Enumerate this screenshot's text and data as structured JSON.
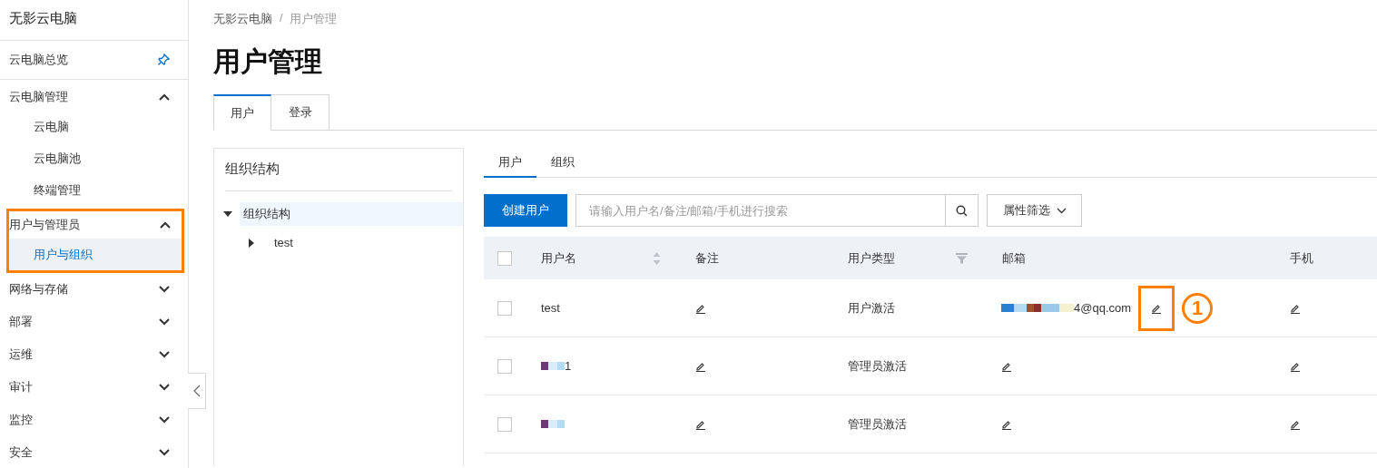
{
  "sidebar": {
    "title": "无影云电脑",
    "pinned_item": {
      "label": "云电脑总览"
    },
    "groups": [
      {
        "label": "云电脑管理",
        "expanded": true,
        "highlighted": false,
        "children": [
          {
            "label": "云电脑",
            "selected": false
          },
          {
            "label": "云电脑池",
            "selected": false
          },
          {
            "label": "终端管理",
            "selected": false
          }
        ]
      },
      {
        "label": "用户与管理员",
        "expanded": true,
        "highlighted": true,
        "children": [
          {
            "label": "用户与组织",
            "selected": true
          }
        ]
      },
      {
        "label": "网络与存储",
        "expanded": false,
        "highlighted": false
      },
      {
        "label": "部署",
        "expanded": false,
        "highlighted": false
      },
      {
        "label": "运维",
        "expanded": false,
        "highlighted": false
      },
      {
        "label": "审计",
        "expanded": false,
        "highlighted": false
      },
      {
        "label": "监控",
        "expanded": false,
        "highlighted": false
      },
      {
        "label": "安全",
        "expanded": false,
        "highlighted": false
      }
    ]
  },
  "breadcrumb": {
    "items": [
      "无影云电脑",
      "用户管理"
    ],
    "separator": "/"
  },
  "page_title": "用户管理",
  "tabs": [
    {
      "label": "用户",
      "selected": true
    },
    {
      "label": "登录",
      "selected": false
    }
  ],
  "org_panel": {
    "title": "组织结构",
    "tree": [
      {
        "label": "组织结构",
        "expanded": true,
        "selected": true,
        "children": [
          {
            "label": "test",
            "expanded": false,
            "selected": false
          }
        ]
      }
    ]
  },
  "subtabs": [
    {
      "label": "用户",
      "selected": true
    },
    {
      "label": "组织",
      "selected": false
    }
  ],
  "toolbar": {
    "create_button": "创建用户",
    "search": {
      "placeholder": "请输入用户名/备注/邮箱/手机进行搜索"
    },
    "filter_button": "属性筛选"
  },
  "table": {
    "select_all_checked": false,
    "columns": [
      {
        "label": "用户名",
        "sortable": true,
        "filterable": false
      },
      {
        "label": "备注",
        "sortable": false,
        "filterable": false
      },
      {
        "label": "用户类型",
        "sortable": false,
        "filterable": true
      },
      {
        "label": "邮箱",
        "sortable": false,
        "filterable": false
      },
      {
        "label": "手机",
        "sortable": false,
        "filterable": false
      }
    ],
    "rows": [
      {
        "checked": false,
        "username": {
          "text": "test",
          "redacted": false
        },
        "user_type": "用户激活",
        "email": {
          "text": "4@qq.com",
          "redacted": true,
          "highlighted": true
        },
        "callout": "1"
      },
      {
        "checked": false,
        "username": {
          "text": "1",
          "redacted": true
        },
        "user_type": "管理员激活",
        "email": {
          "redacted": false,
          "highlighted": false
        }
      },
      {
        "checked": false,
        "username": {
          "redacted": true
        },
        "user_type": "管理员激活",
        "email": {
          "redacted": false,
          "highlighted": false
        }
      }
    ]
  }
}
